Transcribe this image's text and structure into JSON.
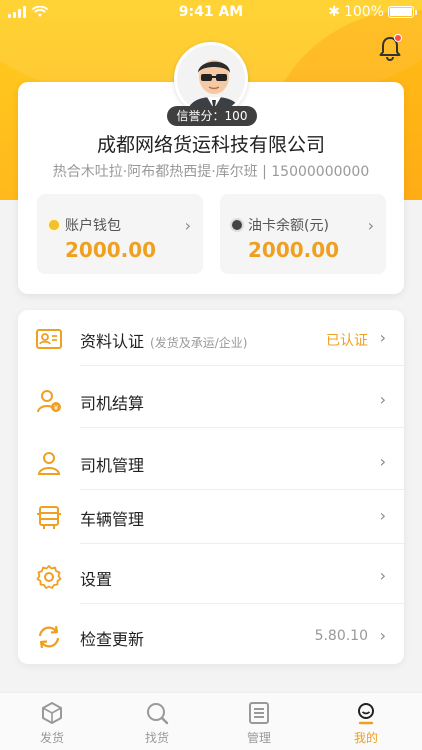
{
  "status_bar": {
    "time": "9:41 AM",
    "battery": "100%"
  },
  "profile": {
    "credit_label": "信誉分：100",
    "company": "成都网络货运科技有限公司",
    "subtitle": "热合木吐拉·阿布都热西提·库尔班 | 15000000000"
  },
  "wallets": [
    {
      "label": "账户钱包",
      "amount": "2000.00",
      "dot_color": "#f2c12e"
    },
    {
      "label": "油卡余额(元)",
      "amount": "2000.00",
      "dot_color": "#444444"
    }
  ],
  "menu": [
    {
      "icon": "id-card-icon",
      "label": "资料认证",
      "sub": "(发货及承运/企业)",
      "right": "已认证"
    },
    {
      "icon": "driver-settlement-icon",
      "label": "司机结算",
      "sub": "",
      "right": ""
    },
    {
      "icon": "driver-manage-icon",
      "label": "司机管理",
      "sub": "",
      "right": ""
    },
    {
      "icon": "truck-icon",
      "label": "车辆管理",
      "sub": "",
      "right": ""
    },
    {
      "icon": "gear-icon",
      "label": "设置",
      "sub": "",
      "right": ""
    },
    {
      "icon": "refresh-icon",
      "label": "检查更新",
      "sub": "",
      "right": "5.80.10"
    }
  ],
  "tabs": [
    {
      "icon": "box-icon",
      "label": "发货"
    },
    {
      "icon": "search-icon",
      "label": "找货"
    },
    {
      "icon": "list-icon",
      "label": "管理"
    },
    {
      "icon": "profile-icon",
      "label": "我的"
    }
  ],
  "colors": {
    "accent": "#f0a020",
    "header": "#ffc21c"
  }
}
